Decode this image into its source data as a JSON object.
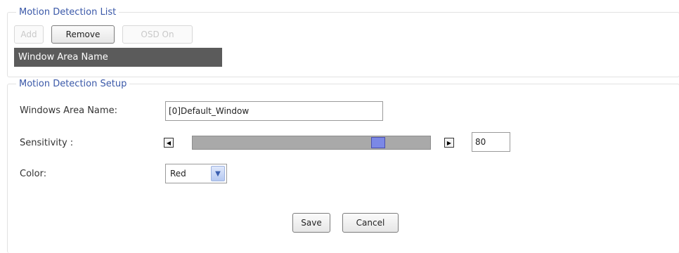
{
  "list_section": {
    "legend": "Motion Detection List",
    "add_label": "Add",
    "remove_label": "Remove",
    "osd_label": "OSD On",
    "column_header": "Window Area Name"
  },
  "setup_section": {
    "legend": "Motion Detection Setup",
    "area_name_label": "Windows Area Name:",
    "area_name_value": "[0]Default_Window",
    "sensitivity_label": "Sensitivity :",
    "sensitivity_value": "80",
    "sensitivity_level_percent": 80,
    "color_label": "Color:",
    "color_value": "Red"
  },
  "actions": {
    "save_label": "Save",
    "cancel_label": "Cancel"
  },
  "icons": {
    "left": "arrow-left-icon",
    "right": "arrow-right-icon",
    "dropdown": "chevron-down-icon"
  }
}
